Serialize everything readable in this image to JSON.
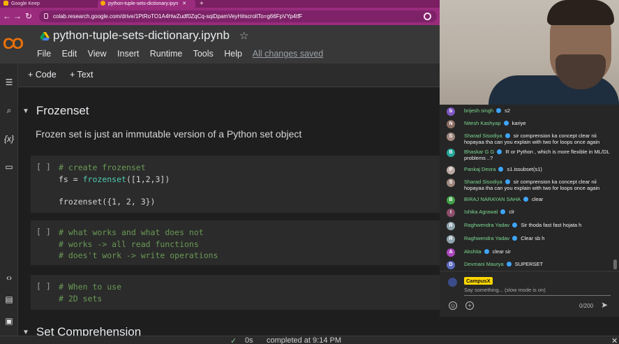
{
  "browser": {
    "tabs": [
      {
        "title": "Google Keep"
      },
      {
        "title": "python-tuple-sets-dictionary.ipyn"
      }
    ],
    "new_tab": "+",
    "url": "colab.research.google.com/drive/1PtRoTO1A4HwZudf0ZqCq-sqiDpamVeyH#scrollTo=g66FpVYp4tfF"
  },
  "colab": {
    "logo": "CO",
    "notebook_title": "python-tuple-sets-dictionary.ipynb",
    "menu": [
      "File",
      "Edit",
      "View",
      "Insert",
      "Runtime",
      "Tools",
      "Help"
    ],
    "save_status": "All changes saved",
    "toolbar": {
      "code_label": "+ Code",
      "text_label": "+ Text"
    }
  },
  "notebook": {
    "section_title": "Frozenset",
    "section_text": "Frozen set is just an immutable version of a Python set object",
    "cells": [
      {
        "run_label": "[ ]",
        "line1": "# create frozenset",
        "line2_pre": "fs = ",
        "line2_fn": "frozenset",
        "line2_post": "([1,2,3])",
        "output": "frozenset({1, 2, 3})"
      },
      {
        "run_label": "[ ]",
        "lines": [
          "# what works and what does not",
          "# works -> all read functions",
          "# does't work -> write operations"
        ]
      },
      {
        "run_label": "[ ]",
        "lines": [
          "# When to use",
          "# 2D sets"
        ]
      }
    ],
    "next_section_title": "Set Comprehension"
  },
  "status_bar": {
    "check": "✓",
    "duration": "0s",
    "completed": "completed at 9:14 PM",
    "close": "✕"
  },
  "chat": {
    "messages": [
      {
        "initial": "b",
        "color": "#7e57c2",
        "name": "brijesh singh",
        "text": "s2"
      },
      {
        "initial": "N",
        "color": "#8d6e63",
        "name": "Nitesh Kashyap",
        "text": "kariye"
      },
      {
        "initial": "S",
        "color": "#a1887f",
        "name": "Sharad Sisodiya",
        "text": "sir comprension ka concept clear nii hopayaa tha can you explain with two for loops once again"
      },
      {
        "initial": "B",
        "color": "#26a69a",
        "name": "Bhaskar G G",
        "text": "R or Python , which is more flexible in ML/DL problems ..?"
      },
      {
        "initial": "P",
        "color": "#bcaaa4",
        "name": "Pankaj Deora",
        "text": "s1.issubset(s1)"
      },
      {
        "initial": "S",
        "color": "#a1887f",
        "name": "Sharad Sisodiya",
        "text": "sir comprension ka concept clear nii hopayaa tha can you explain with two for loops once again"
      },
      {
        "initial": "B",
        "color": "#43a047",
        "name": "BIRAJ NARAYAN SAHA",
        "text": "clear"
      },
      {
        "initial": "I",
        "color": "#8d4e6b",
        "name": "Ishika Agrawal",
        "text": "clr"
      },
      {
        "initial": "R",
        "color": "#90a4ae",
        "name": "Raghwendra Yadav",
        "text": "Sir thoda fast fast hojata h"
      },
      {
        "initial": "R",
        "color": "#90a4ae",
        "name": "Raghwendra Yadav",
        "text": "Clear sb h"
      },
      {
        "initial": "A",
        "color": "#ab47bc",
        "name": "Akshita",
        "text": "clear sir"
      },
      {
        "initial": "D",
        "color": "#5c6bc0",
        "name": "Devmani Maurya",
        "text": "SUPERSET"
      }
    ],
    "compose": {
      "user": "CampusX",
      "placeholder": "Say something... (slow mode is on)",
      "counter": "0/200"
    }
  }
}
